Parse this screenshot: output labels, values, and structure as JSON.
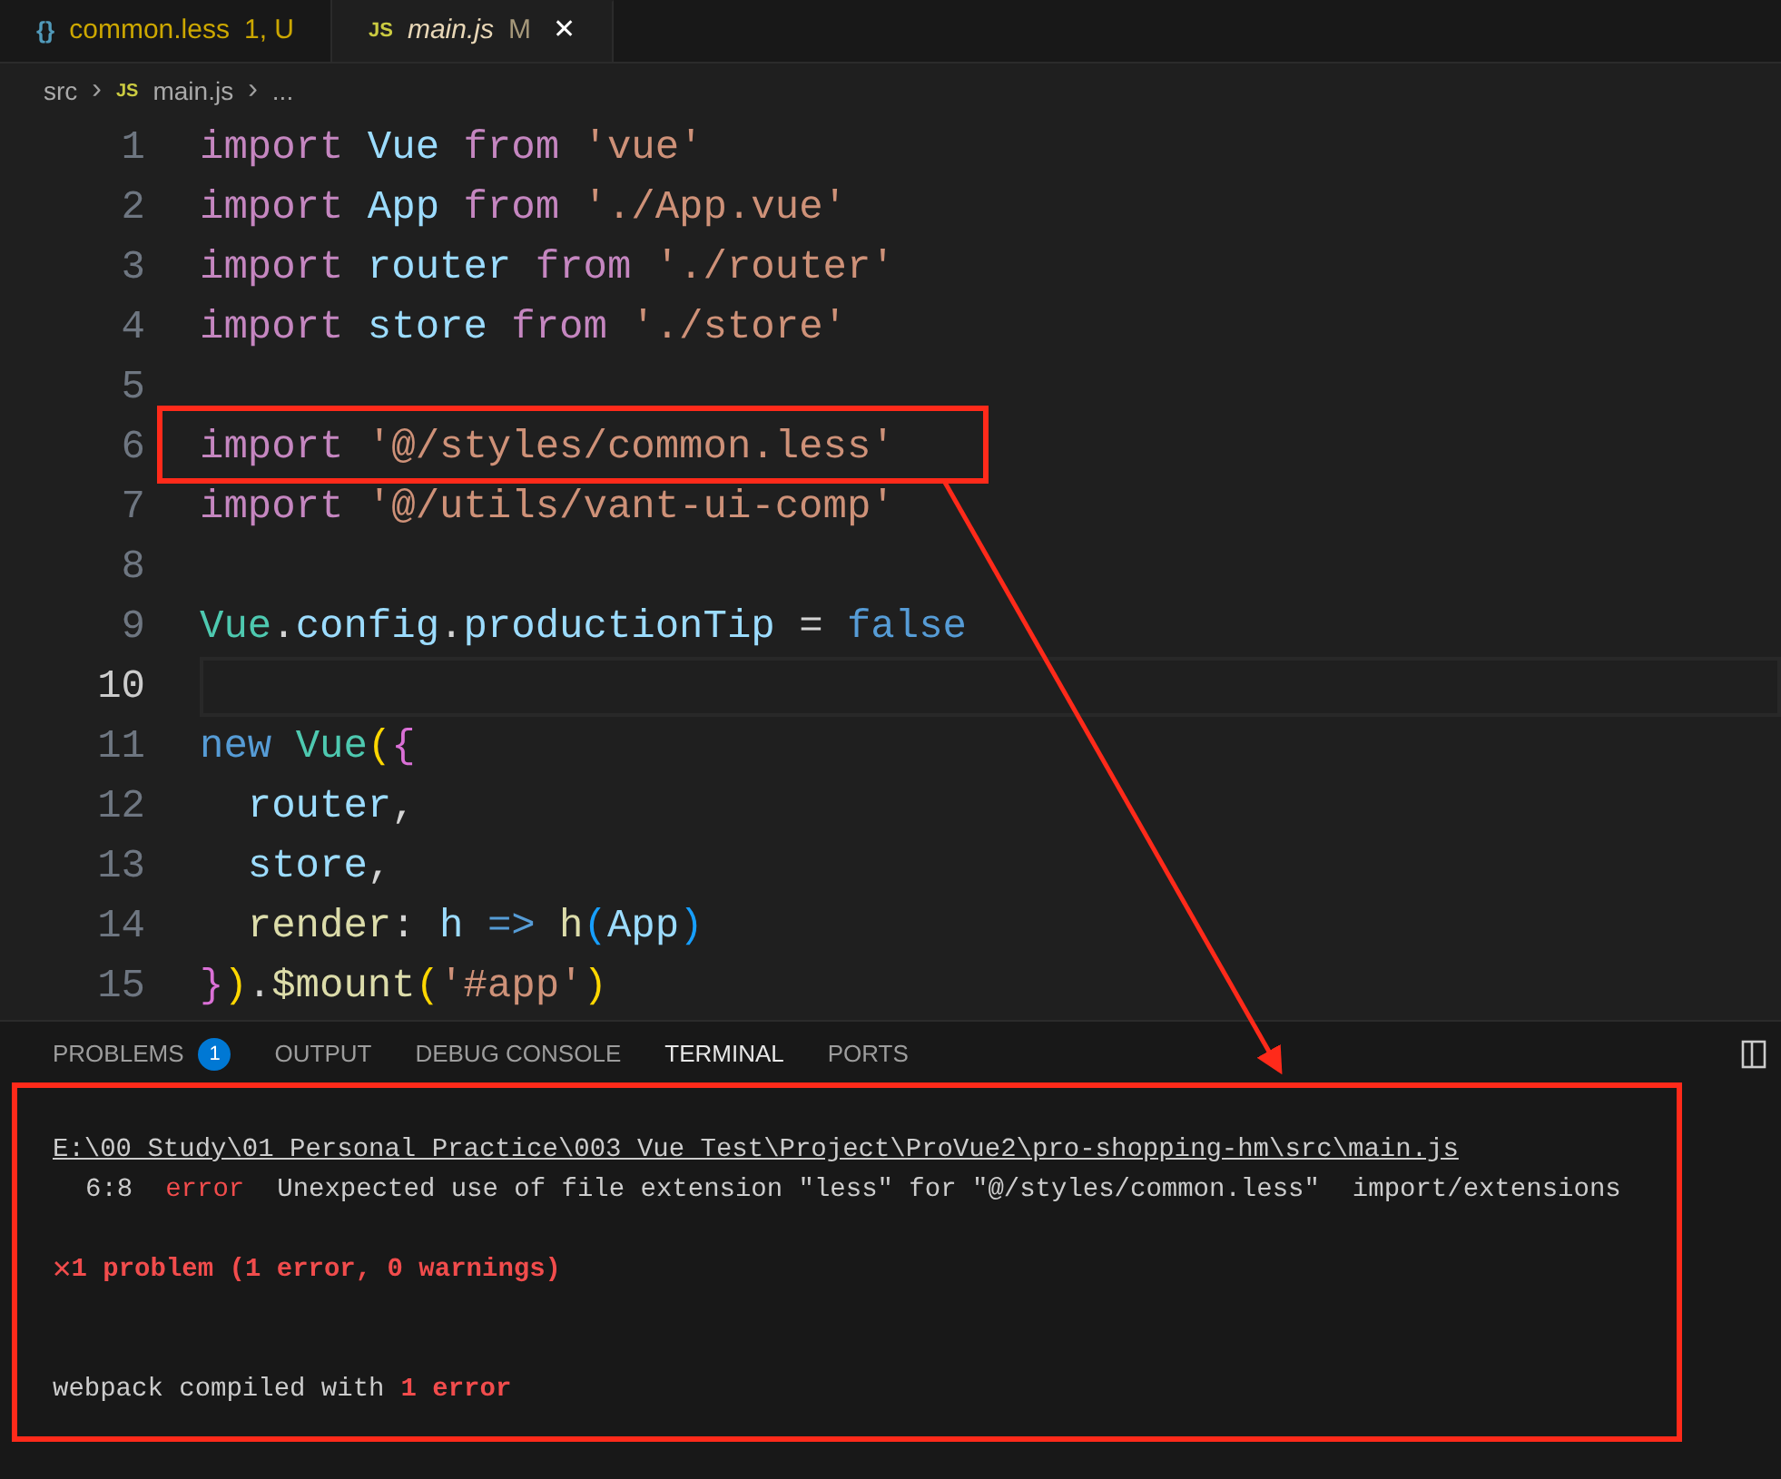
{
  "editor_tabs": [
    {
      "icon": "{}",
      "kind": "braces",
      "label": "common.less",
      "badge": "1, U",
      "selected": false
    },
    {
      "icon": "JS",
      "kind": "js",
      "label": "main.js",
      "badge": "M",
      "selected": true,
      "close_glyph": "✕"
    }
  ],
  "breadcrumbs": [
    {
      "text": "src",
      "kind": "folder"
    },
    {
      "text": "›",
      "kind": "separator"
    },
    {
      "text": "JS",
      "kind": "js"
    },
    {
      "text": "main.js",
      "kind": "file"
    },
    {
      "text": "›",
      "kind": "separator"
    },
    {
      "text": "...",
      "kind": "more"
    }
  ],
  "code_lines": [
    {
      "number": "1",
      "selected": false,
      "tokens": [
        {
          "text": "import ",
          "kind": "keyword"
        },
        {
          "text": "Vue ",
          "kind": "variable"
        },
        {
          "text": "from ",
          "kind": "keyword"
        },
        {
          "text": "'vue'",
          "kind": "string"
        }
      ]
    },
    {
      "number": "2",
      "selected": false,
      "tokens": [
        {
          "text": "import ",
          "kind": "keyword"
        },
        {
          "text": "App ",
          "kind": "variable"
        },
        {
          "text": "from ",
          "kind": "keyword"
        },
        {
          "text": "'./App.vue'",
          "kind": "string"
        }
      ]
    },
    {
      "number": "3",
      "selected": false,
      "tokens": [
        {
          "text": "import ",
          "kind": "keyword"
        },
        {
          "text": "router ",
          "kind": "variable"
        },
        {
          "text": "from ",
          "kind": "keyword"
        },
        {
          "text": "'./router'",
          "kind": "string"
        }
      ]
    },
    {
      "number": "4",
      "selected": false,
      "tokens": [
        {
          "text": "import ",
          "kind": "keyword"
        },
        {
          "text": "store ",
          "kind": "variable"
        },
        {
          "text": "from ",
          "kind": "keyword"
        },
        {
          "text": "'./store'",
          "kind": "string"
        }
      ]
    },
    {
      "number": "5",
      "selected": false
    },
    {
      "number": "6",
      "selected": false,
      "tokens": [
        {
          "text": "import ",
          "kind": "keyword"
        },
        {
          "text": "'@/styles/common.less'",
          "kind": "string"
        }
      ]
    },
    {
      "number": "7",
      "selected": false,
      "tokens": [
        {
          "text": "import ",
          "kind": "keyword"
        },
        {
          "text": "'@/utils/vant-ui-comp'",
          "kind": "string"
        }
      ]
    },
    {
      "number": "8",
      "selected": false
    },
    {
      "number": "9",
      "selected": false,
      "tokens": [
        {
          "text": "Vue",
          "kind": "class"
        },
        {
          "text": ".",
          "kind": "plain"
        },
        {
          "text": "config",
          "kind": "variable"
        },
        {
          "text": ".",
          "kind": "plain"
        },
        {
          "text": "productionTip ",
          "kind": "variable"
        },
        {
          "text": "= ",
          "kind": "plain"
        },
        {
          "text": "false",
          "kind": "constant"
        }
      ]
    },
    {
      "number": "10",
      "selected": true
    },
    {
      "number": "11",
      "selected": false,
      "tokens": [
        {
          "text": "new ",
          "kind": "constant"
        },
        {
          "text": "Vue",
          "kind": "class"
        },
        {
          "text": "(",
          "kind": "bracket1"
        },
        {
          "text": "{",
          "kind": "bracket2"
        }
      ]
    },
    {
      "number": "12",
      "selected": false,
      "tokens": [
        {
          "text": "  router",
          "kind": "variable"
        },
        {
          "text": ",",
          "kind": "plain"
        }
      ]
    },
    {
      "number": "13",
      "selected": false,
      "tokens": [
        {
          "text": "  store",
          "kind": "variable"
        },
        {
          "text": ",",
          "kind": "plain"
        }
      ]
    },
    {
      "number": "14",
      "selected": false,
      "tokens": [
        {
          "text": "  render",
          "kind": "function"
        },
        {
          "text": ": ",
          "kind": "plain"
        },
        {
          "text": "h ",
          "kind": "variable"
        },
        {
          "text": "=> ",
          "kind": "constant"
        },
        {
          "text": "h",
          "kind": "function"
        },
        {
          "text": "(",
          "kind": "bracket3"
        },
        {
          "text": "App",
          "kind": "variable"
        },
        {
          "text": ")",
          "kind": "bracket3"
        }
      ]
    },
    {
      "number": "15",
      "selected": false,
      "tokens": [
        {
          "text": "}",
          "kind": "bracket2"
        },
        {
          "text": ")",
          "kind": "bracket1"
        },
        {
          "text": ".",
          "kind": "plain"
        },
        {
          "text": "$mount",
          "kind": "function"
        },
        {
          "text": "(",
          "kind": "bracket1"
        },
        {
          "text": "'#app'",
          "kind": "string"
        },
        {
          "text": ")",
          "kind": "bracket1"
        }
      ]
    }
  ],
  "panel_tabs": [
    {
      "label": "PROBLEMS",
      "badge": "1",
      "selected": false
    },
    {
      "label": "OUTPUT",
      "selected": false
    },
    {
      "label": "DEBUG CONSOLE",
      "selected": false
    },
    {
      "label": "TERMINAL",
      "selected": true
    },
    {
      "label": "PORTS",
      "selected": false
    }
  ],
  "terminal_lines": [
    {
      "kind": "path",
      "text": "E:\\00 Study\\01 Personal Practice\\003 Vue Test\\Project\\ProVue2\\pro-shopping-hm\\src\\main.js"
    },
    {
      "kind": "lint",
      "position": "6:8",
      "severity": "error",
      "message": "Unexpected use of file extension \"less\" for \"@/styles/common.less\"",
      "rule": "import/extensions"
    },
    {
      "kind": "blank"
    },
    {
      "kind": "summary",
      "icon": "✕",
      "text": "1 problem (1 error, 0 warnings)"
    },
    {
      "kind": "blank"
    },
    {
      "kind": "blank"
    },
    {
      "kind": "status",
      "text": "webpack compiled with",
      "highlight": "1 error"
    }
  ]
}
